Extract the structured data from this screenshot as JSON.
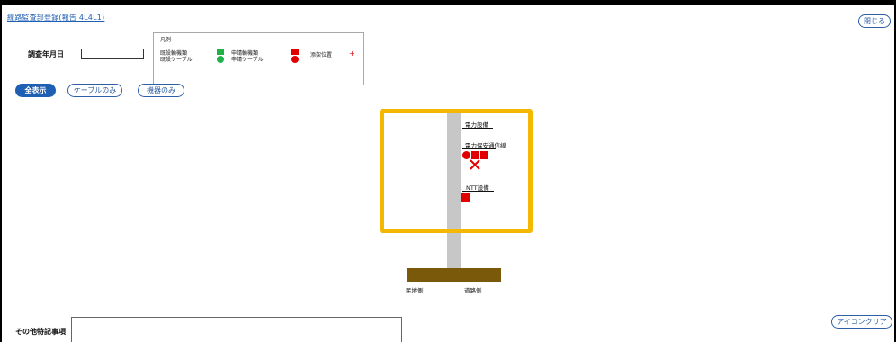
{
  "header": {
    "title": "線路監査部登録(報告 4L4L1)",
    "close_label": "閉じる"
  },
  "form": {
    "survey_date_label": "調査年月日",
    "survey_date_value": "",
    "notes_label": "その他特記事項",
    "notes_value": ""
  },
  "legend": {
    "title": "凡例",
    "existing_equipment": "既設輪機類",
    "existing_cable": "既設ケーブル",
    "applied_equipment": "申請輪機類",
    "applied_cable": "申請ケーブル",
    "attachment_position": "添架位置",
    "plus_mark": "+",
    "colors": {
      "existing": "#1fb24a",
      "applied": "#e00000",
      "attachment": "#e00000"
    }
  },
  "filters": {
    "show_all": "全表示",
    "cable_only": "ケーブルのみ",
    "equipment_only": "機器のみ"
  },
  "diagram": {
    "power_equipment": "電力設備",
    "power_safety_comm": "電力保安通信線",
    "ntt_equipment": "NTT設備",
    "private_side": "民地側",
    "road_side": "道路側",
    "highlight_color": "#f5b800"
  },
  "icon_clear_label": "アイコンクリア"
}
